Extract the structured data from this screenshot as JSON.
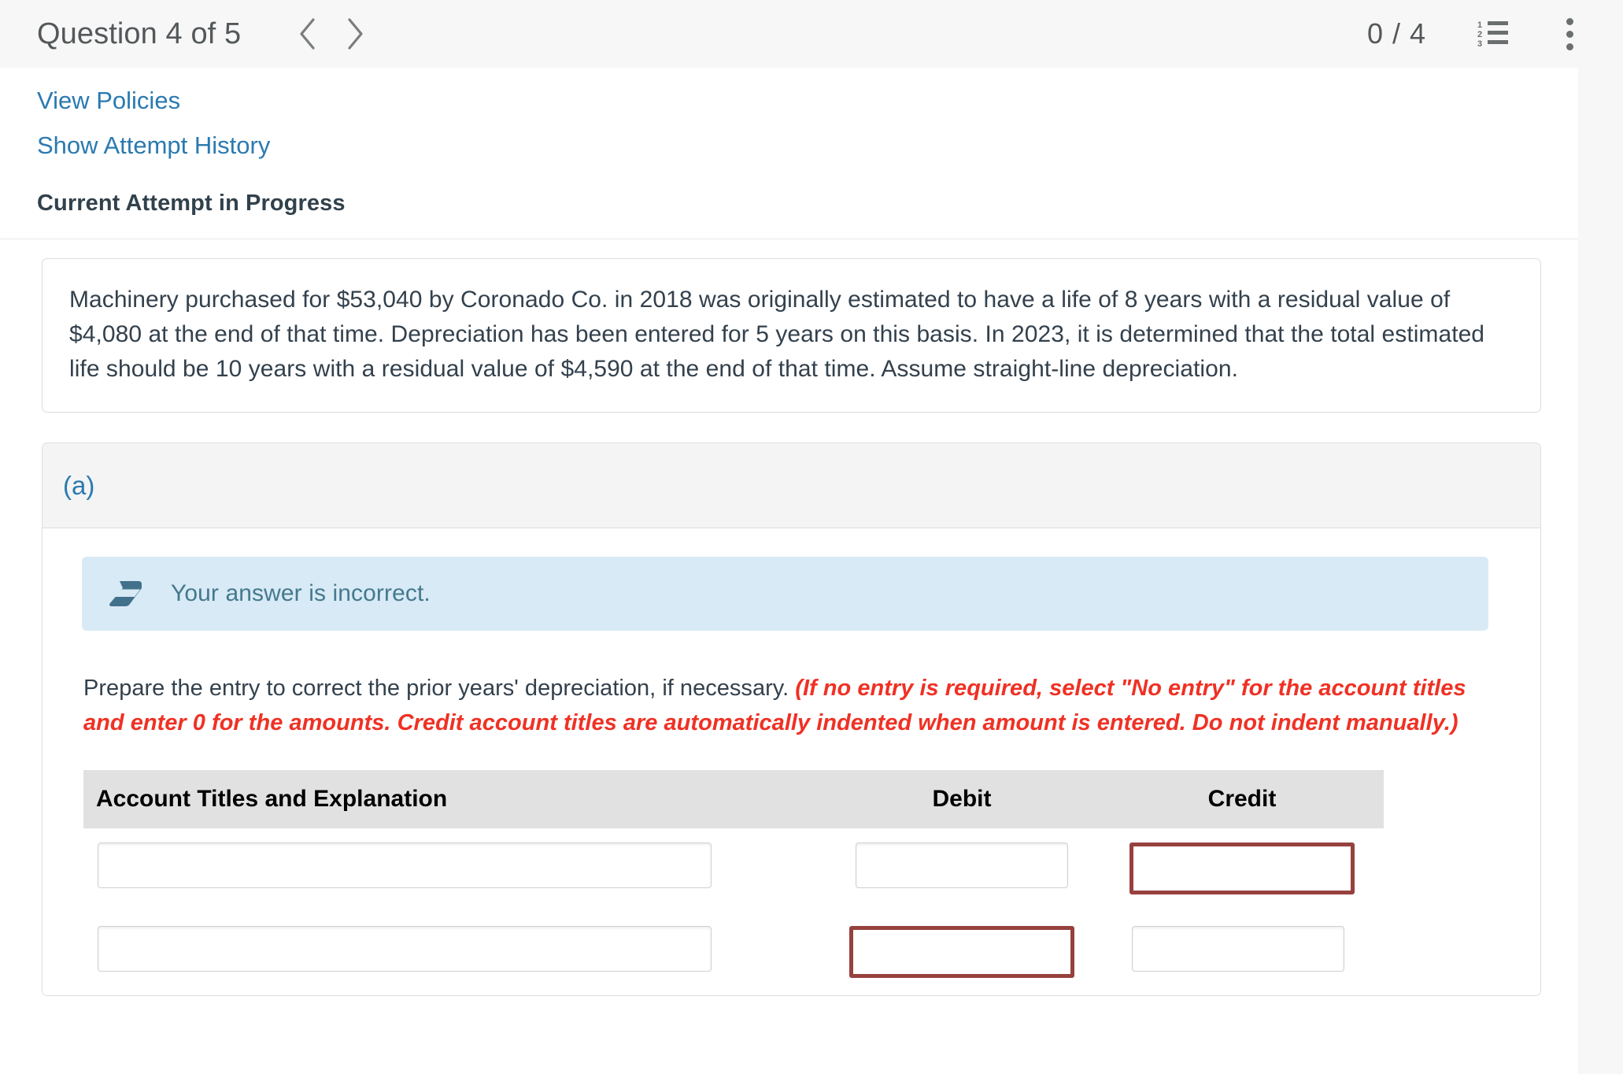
{
  "header": {
    "question_label": "Question 4 of 5",
    "prev_icon": "chevron-left-icon",
    "next_icon": "chevron-right-icon",
    "score": "0 / 4",
    "list_icon": "numbered-list-icon",
    "list_numbers": [
      "1",
      "2",
      "3"
    ],
    "menu_icon": "kebab-menu-icon"
  },
  "links": {
    "view_policies": "View Policies",
    "show_attempt_history": "Show Attempt History"
  },
  "attempt": {
    "status_title": "Current Attempt in Progress"
  },
  "question": {
    "text": "Machinery purchased for $53,040 by Coronado Co. in 2018 was originally estimated to have a life of 8 years with a residual value of $4,080 at the end of that time. Depreciation has been entered for 5 years on this basis. In 2023, it is determined that the total estimated life should be 10 years with a residual value of $4,590 at the end of that time. Assume straight-line depreciation."
  },
  "part": {
    "label": "(a)",
    "alert": {
      "icon": "eraser-icon",
      "text": "Your answer is incorrect."
    },
    "instruction_main": "Prepare the entry to correct the prior years' depreciation, if necessary. ",
    "instruction_hint": "(If no entry is required, select \"No entry\" for the account titles and enter 0 for the amounts. Credit account titles are automatically indented when amount is entered. Do not indent manually.)",
    "table": {
      "columns": {
        "account": "Account Titles and Explanation",
        "debit": "Debit",
        "credit": "Credit"
      },
      "rows": [
        {
          "account": "",
          "debit": "",
          "credit": ""
        },
        {
          "account": "",
          "debit": "",
          "credit": ""
        }
      ]
    }
  },
  "colors": {
    "link": "#2a7ab0",
    "accent_blue": "#2a7ab0",
    "error_red": "#ef3124",
    "error_border": "#97413e",
    "alert_bg": "#d8eaf5",
    "alert_text": "#44798f",
    "page_bg": "#f7f7f7",
    "table_header_bg": "#e1e1e1"
  }
}
